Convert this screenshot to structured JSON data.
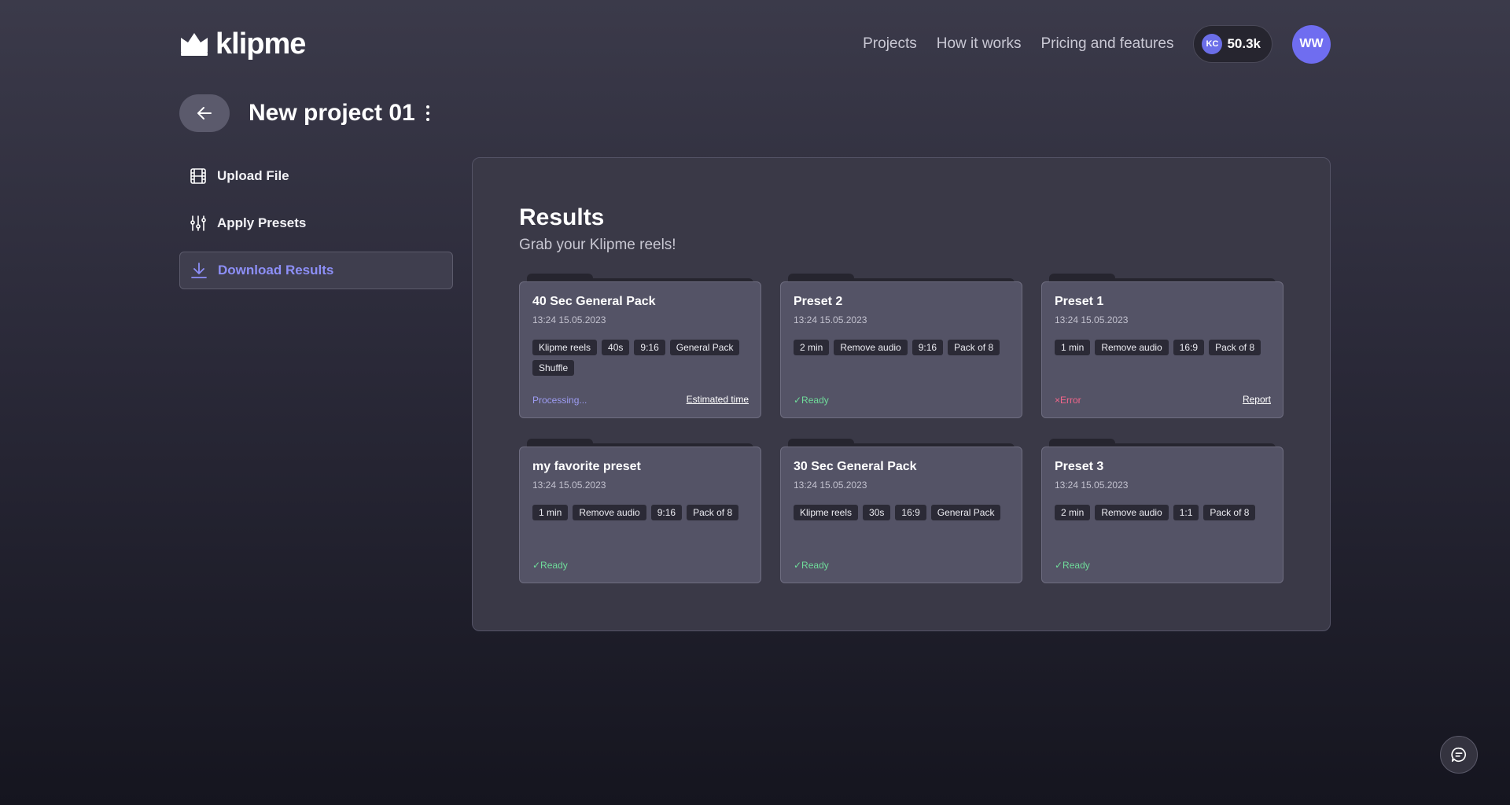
{
  "header": {
    "logo_text": "klipme",
    "nav": [
      "Projects",
      "How it works",
      "Pricing and features"
    ],
    "credits_badge": "KC",
    "credits_value": "50.3k",
    "avatar_initials": "WW"
  },
  "title": "New project 01",
  "sidebar": {
    "items": [
      {
        "label": "Upload File",
        "icon": "film-icon"
      },
      {
        "label": "Apply Presets",
        "icon": "sliders-icon"
      },
      {
        "label": "Download Results",
        "icon": "download-icon",
        "active": true
      }
    ]
  },
  "results": {
    "title": "Results",
    "subtitle": "Grab your Klipme reels!",
    "cards": [
      {
        "title": "40 Sec General Pack",
        "date": "13:24 15.05.2023",
        "tags": [
          "Klipme reels",
          "40s",
          "9:16",
          "General Pack",
          "Shuffle"
        ],
        "status": "Processing...",
        "status_type": "processing",
        "link": "Estimated time"
      },
      {
        "title": "Preset 2",
        "date": "13:24 15.05.2023",
        "tags": [
          "2 min",
          "Remove audio",
          "9:16",
          "Pack of 8"
        ],
        "status": "✓Ready",
        "status_type": "ready",
        "link": ""
      },
      {
        "title": "Preset 1",
        "date": "13:24 15.05.2023",
        "tags": [
          "1 min",
          "Remove audio",
          "16:9",
          "Pack of 8"
        ],
        "status": "×Error",
        "status_type": "error",
        "link": "Report"
      },
      {
        "title": "my favorite preset",
        "date": "13:24 15.05.2023",
        "tags": [
          "1 min",
          "Remove audio",
          "9:16",
          "Pack of 8"
        ],
        "status": "✓Ready",
        "status_type": "ready",
        "link": ""
      },
      {
        "title": "30 Sec General Pack",
        "date": "13:24 15.05.2023",
        "tags": [
          "Klipme reels",
          "30s",
          "16:9",
          "General Pack"
        ],
        "status": "✓Ready",
        "status_type": "ready",
        "link": ""
      },
      {
        "title": "Preset 3",
        "date": "13:24 15.05.2023",
        "tags": [
          "2 min",
          "Remove audio",
          "1:1",
          "Pack of 8"
        ],
        "status": "✓Ready",
        "status_type": "ready",
        "link": ""
      }
    ]
  },
  "colors": {
    "accent": "#6f6df0",
    "ready": "#6fdc9a",
    "error": "#f2668b",
    "processing": "#9d9cf3"
  }
}
